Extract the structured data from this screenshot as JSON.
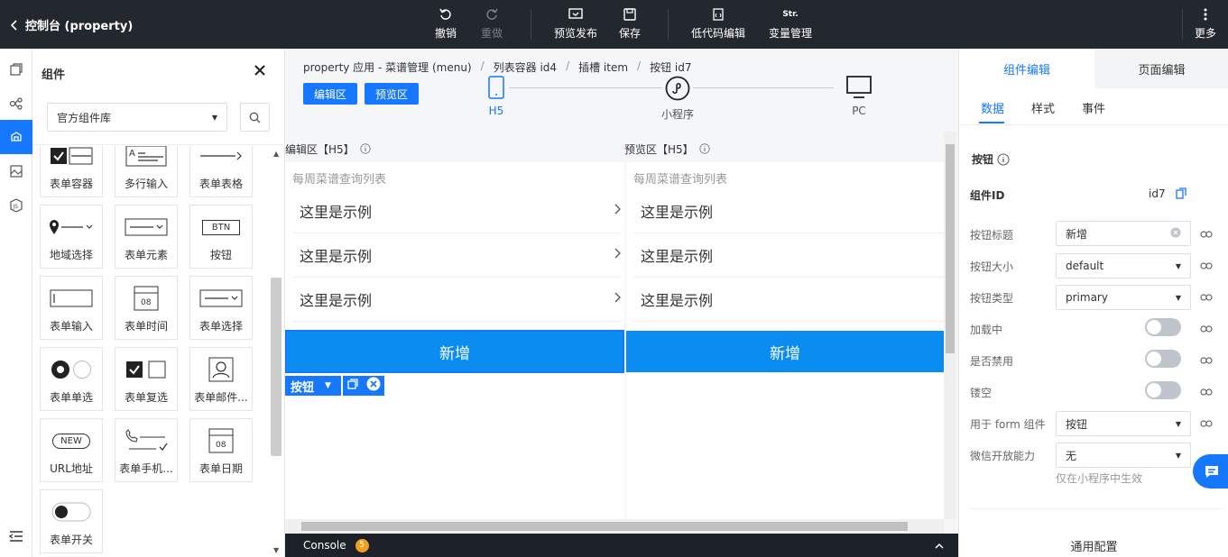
{
  "topbar": {
    "back_title": "控制台 (property)",
    "undo": "撤销",
    "redo": "重做",
    "preview_publish": "预览发布",
    "save": "保存",
    "lowcode_edit": "低代码编辑",
    "var_manage": "变量管理",
    "more": "更多",
    "var_icon_text": "Str."
  },
  "component_panel": {
    "title": "组件",
    "library_select": "官方组件库",
    "components": [
      {
        "label": "表单容器"
      },
      {
        "label": "多行输入"
      },
      {
        "label": "表单表格"
      },
      {
        "label": "地域选择"
      },
      {
        "label": "表单元素"
      },
      {
        "label": "按钮"
      },
      {
        "label": "表单输入"
      },
      {
        "label": "表单时间"
      },
      {
        "label": "表单选择"
      },
      {
        "label": "表单单选"
      },
      {
        "label": "表单复选"
      },
      {
        "label": "表单邮件..."
      },
      {
        "label": "URL地址"
      },
      {
        "label": "表单手机..."
      },
      {
        "label": "表单日期"
      },
      {
        "label": "表单开关"
      }
    ],
    "btn_icon_text": "BTN",
    "new_icon_text": "NEW",
    "time_icon_text": "08",
    "date_icon_text": "08",
    "textarea_icon_text": "A"
  },
  "breadcrumb": [
    "property 应用 - 菜谱管理 (menu)",
    "列表容器 id4",
    "插槽 item",
    "按钮 id7"
  ],
  "modes": {
    "edit": "编辑区",
    "preview": "预览区"
  },
  "devices": [
    {
      "label": "H5"
    },
    {
      "label": "小程序"
    },
    {
      "label": "PC"
    }
  ],
  "edit_area": {
    "header": "编辑区【H5】",
    "list_title": "每周菜谱查询列表",
    "items": [
      "这里是示例",
      "这里是示例",
      "这里是示例"
    ],
    "button": "新增",
    "selected_tag": "按钮"
  },
  "preview_area": {
    "header": "预览区【H5】",
    "list_title": "每周菜谱查询列表",
    "items": [
      "这里是示例",
      "这里是示例",
      "这里是示例"
    ],
    "button": "新增"
  },
  "console": {
    "label": "Console",
    "count": "5"
  },
  "right_panel": {
    "tabs": [
      "组件编辑",
      "页面编辑"
    ],
    "subtabs": [
      "数据",
      "样式",
      "事件"
    ],
    "section_title": "按钮",
    "component_id_label": "组件ID",
    "component_id": "id7",
    "props": {
      "title_label": "按钮标题",
      "title_value": "新增",
      "size_label": "按钮大小",
      "size_value": "default",
      "type_label": "按钮类型",
      "type_value": "primary",
      "loading_label": "加载中",
      "loading": false,
      "disabled_label": "是否禁用",
      "disabled": false,
      "hollow_label": "镂空",
      "hollow": false,
      "form_label": "用于 form 组件",
      "form_value": "按钮",
      "wechat_label": "微信开放能力",
      "wechat_value": "无",
      "wechat_hint": "仅在小程序中生效"
    },
    "general_config": "通用配置"
  },
  "colors": {
    "accent": "#1677ff",
    "topbar": "#23272e",
    "primary_button": "#0a8cf0"
  }
}
